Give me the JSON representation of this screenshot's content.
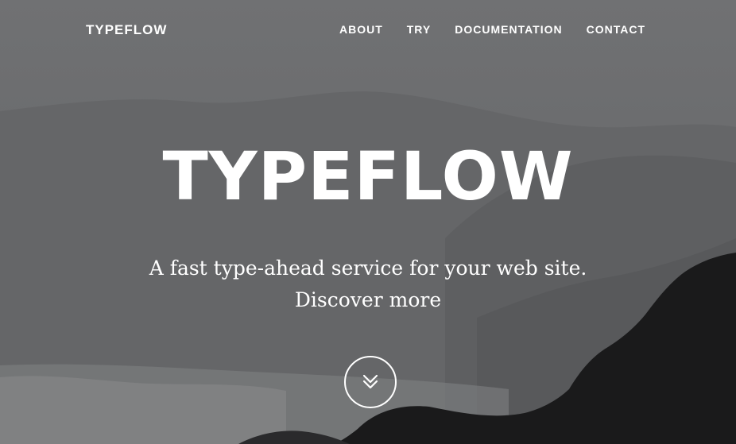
{
  "nav": {
    "brand": "TYPEFLOW",
    "links": [
      {
        "label": "ABOUT"
      },
      {
        "label": "TRY"
      },
      {
        "label": "DOCUMENTATION"
      },
      {
        "label": "CONTACT"
      }
    ]
  },
  "hero": {
    "title": "TYPEFLOW",
    "tagline": "A fast type-ahead service for your web site.",
    "discover_label": "Discover more",
    "scroll_icon": "double-chevron-down-icon"
  },
  "colors": {
    "text": "#ffffff",
    "background": "#6e6f71",
    "rocks": "#1a1a1b"
  }
}
